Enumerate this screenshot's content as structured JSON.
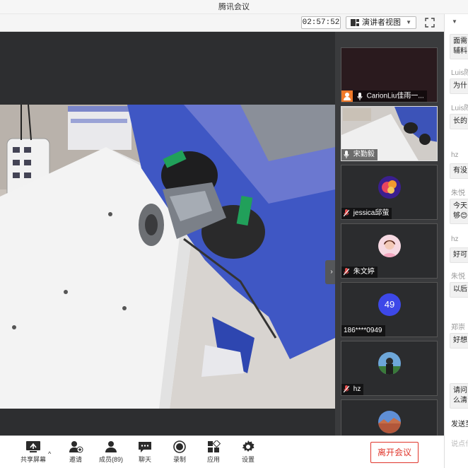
{
  "window": {
    "title": "腾讯会议"
  },
  "toolbar": {
    "timer": "02:57:52",
    "view_mode": "演讲者视图",
    "view_caret": "▼"
  },
  "participants": [
    {
      "name": "CarionLiu佳雨一...",
      "mic": "mic-on-white",
      "badge": "host"
    },
    {
      "name": "宋勤毅",
      "mic": "mic-on-white"
    },
    {
      "name": "jessica邱萤",
      "mic": "mic-muted-red"
    },
    {
      "name": "朱文婷",
      "mic": "mic-muted-red"
    },
    {
      "name": "186****0949",
      "avatar_text": "49",
      "avatar_color": "#3d48e8"
    },
    {
      "name": "hz",
      "mic": "mic-muted-red"
    }
  ],
  "chat": {
    "dropdown_caret": "▼",
    "messages": [
      {
        "sender": "",
        "text_lines": [
          "面需",
          "辅料"
        ]
      },
      {
        "sender": "Luis陈",
        "text_lines": [
          "为什"
        ]
      },
      {
        "sender": "Luis陈",
        "text_lines": [
          "长的"
        ]
      },
      {
        "sender": "hz",
        "text_lines": [
          "有没"
        ]
      },
      {
        "sender": "朱悦",
        "text_lines": [
          "今天",
          "够😊"
        ]
      },
      {
        "sender": "hz",
        "text_lines": [
          "好可"
        ]
      },
      {
        "sender": "朱悦",
        "text_lines": [
          "以后"
        ]
      },
      {
        "sender": "郑崇",
        "text_lines": [
          "好想"
        ]
      },
      {
        "sender": "",
        "text_lines": [
          "请问",
          "么清"
        ]
      }
    ],
    "send_label": "发送至",
    "input_placeholder": "说点什"
  },
  "bottom_bar": {
    "share_screen": "共享屏幕",
    "share_caret": "^",
    "invite": "邀请",
    "members": "成员(89)",
    "chat": "聊天",
    "record": "录制",
    "apps": "应用",
    "settings": "设置",
    "leave": "离开会议"
  },
  "colors": {
    "leave_red": "#e0352b",
    "stage_bg": "#2d2e30",
    "muted_red": "#e34c4c"
  }
}
